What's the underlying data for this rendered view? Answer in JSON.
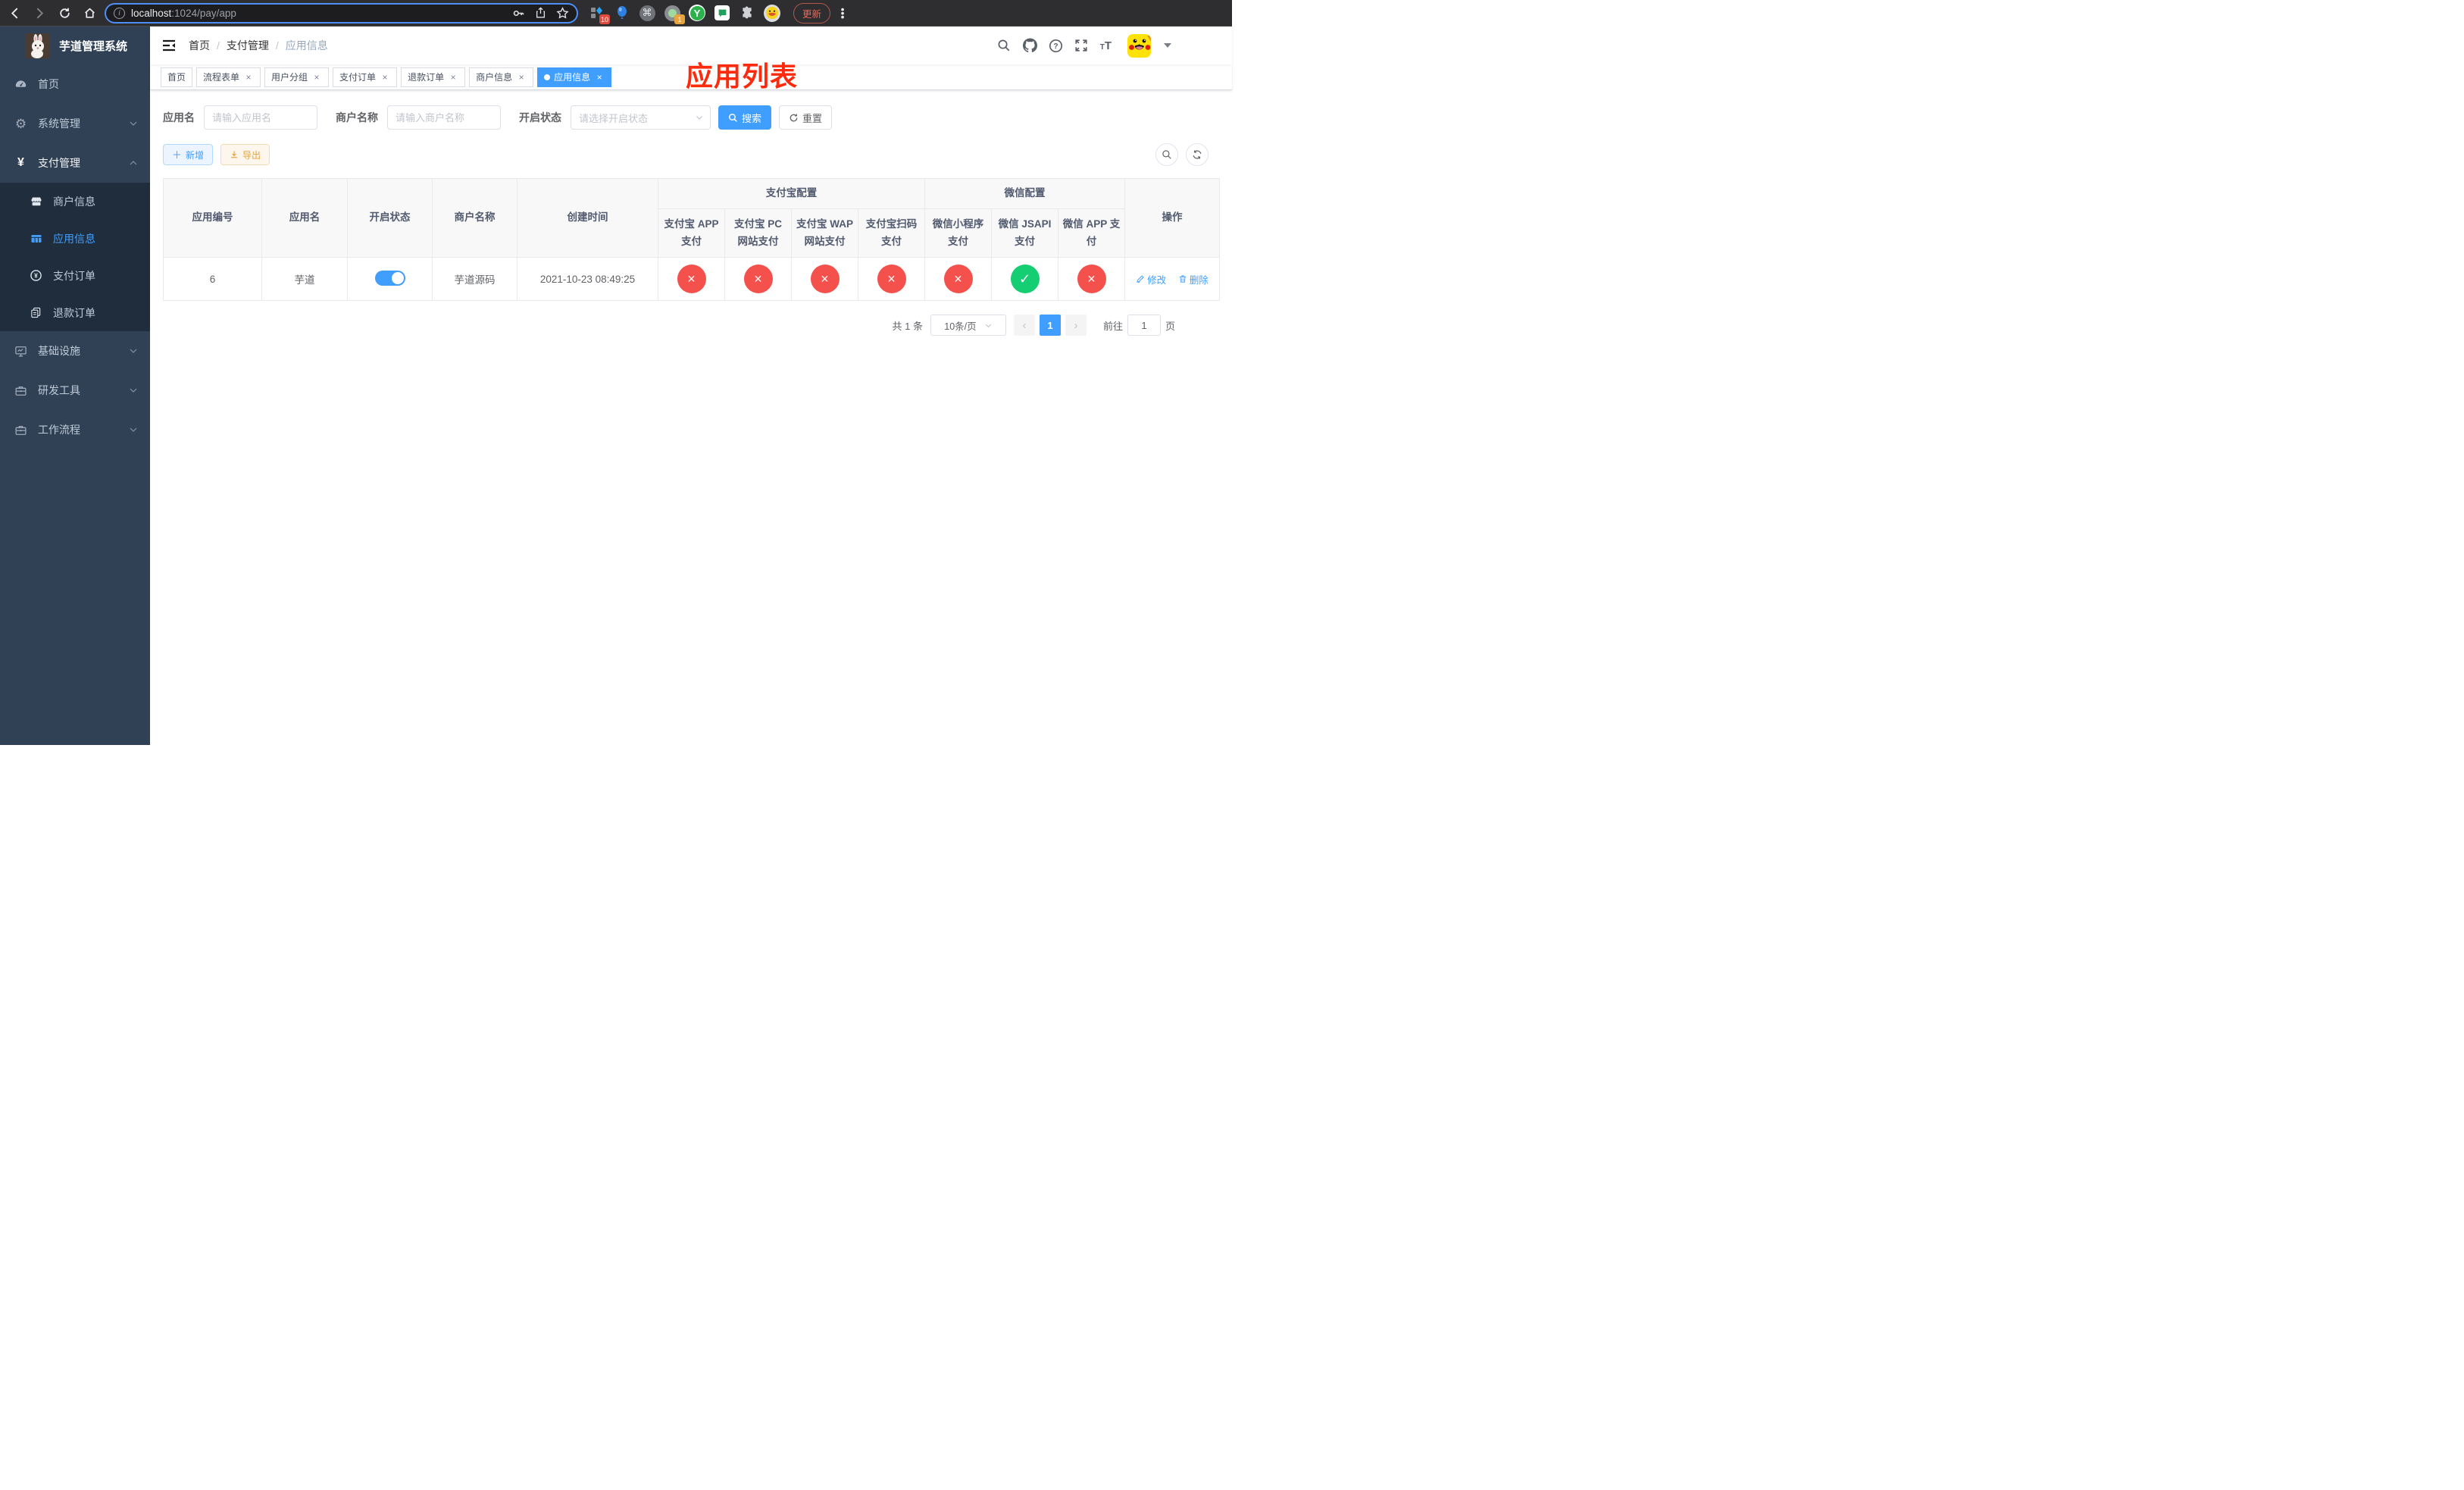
{
  "colors": {
    "accent": "#409eff",
    "danger": "#f4514c",
    "success": "#15cd72",
    "warning": "#e6a23c",
    "sidebar_bg": "#304156",
    "submenu_bg": "#1f2d3d",
    "annotation_red": "#fd2b0d"
  },
  "browser": {
    "url_host": "localhost",
    "url_rest": ":1024/pay/app",
    "ext_badge_blue_diamond": "10",
    "ext_badge_green_circle": "1",
    "ext_y_label": "Y",
    "update_button": "更新"
  },
  "annotation": {
    "text": "应用列表"
  },
  "sidebar": {
    "title": "芋道管理系统",
    "menu": [
      {
        "label": "首页"
      },
      {
        "label": "系统管理"
      },
      {
        "label": "支付管理"
      },
      {
        "label": "基础设施"
      },
      {
        "label": "研发工具"
      },
      {
        "label": "工作流程"
      }
    ],
    "submenu": [
      {
        "label": "商户信息"
      },
      {
        "label": "应用信息"
      },
      {
        "label": "支付订单"
      },
      {
        "label": "退款订单"
      }
    ]
  },
  "breadcrumb": {
    "items": [
      "首页",
      "支付管理",
      "应用信息"
    ],
    "separator": "/"
  },
  "tabs": [
    {
      "label": "首页"
    },
    {
      "label": "流程表单"
    },
    {
      "label": "用户分组"
    },
    {
      "label": "支付订单"
    },
    {
      "label": "退款订单"
    },
    {
      "label": "商户信息"
    },
    {
      "label": "应用信息"
    }
  ],
  "tab_close_glyph": "×",
  "filters": {
    "app_name_label": "应用名",
    "app_name_placeholder": "请输入应用名",
    "merchant_label": "商户名称",
    "merchant_placeholder": "请输入商户名称",
    "status_label": "开启状态",
    "status_placeholder": "请选择开启状态",
    "search_button": "搜索",
    "reset_button": "重置"
  },
  "actions": {
    "add_button": "新增",
    "export_button": "导出"
  },
  "table": {
    "columns": {
      "id": "应用编号",
      "name": "应用名",
      "enabled": "开启状态",
      "merchant": "商户名称",
      "created": "创建时间",
      "operation": "操作"
    },
    "groups": {
      "alipay": "支付宝配置",
      "wechat": "微信配置"
    },
    "subcolumns": [
      "支付宝 APP 支付",
      "支付宝 PC 网站支付",
      "支付宝 WAP 网站支付",
      "支付宝扫码支付",
      "微信小程序支付",
      "微信 JSAPI 支付",
      "微信 APP 支付"
    ],
    "glyph_no": "×",
    "glyph_yes": "✓",
    "rows": [
      {
        "id": "6",
        "name": "芋道",
        "enabled": true,
        "merchant": "芋道源码",
        "created": "2021-10-23 08:49:25",
        "statuses": [
          "no",
          "no",
          "no",
          "no",
          "no",
          "yes",
          "no"
        ],
        "edit": "修改",
        "delete": "删除"
      }
    ]
  },
  "pagination": {
    "total": "共 1 条",
    "page_size": "10条/页",
    "prev_glyph": "‹",
    "page": "1",
    "next_glyph": "›",
    "goto_prefix": "前往",
    "goto_value": "1",
    "goto_suffix": "页"
  }
}
